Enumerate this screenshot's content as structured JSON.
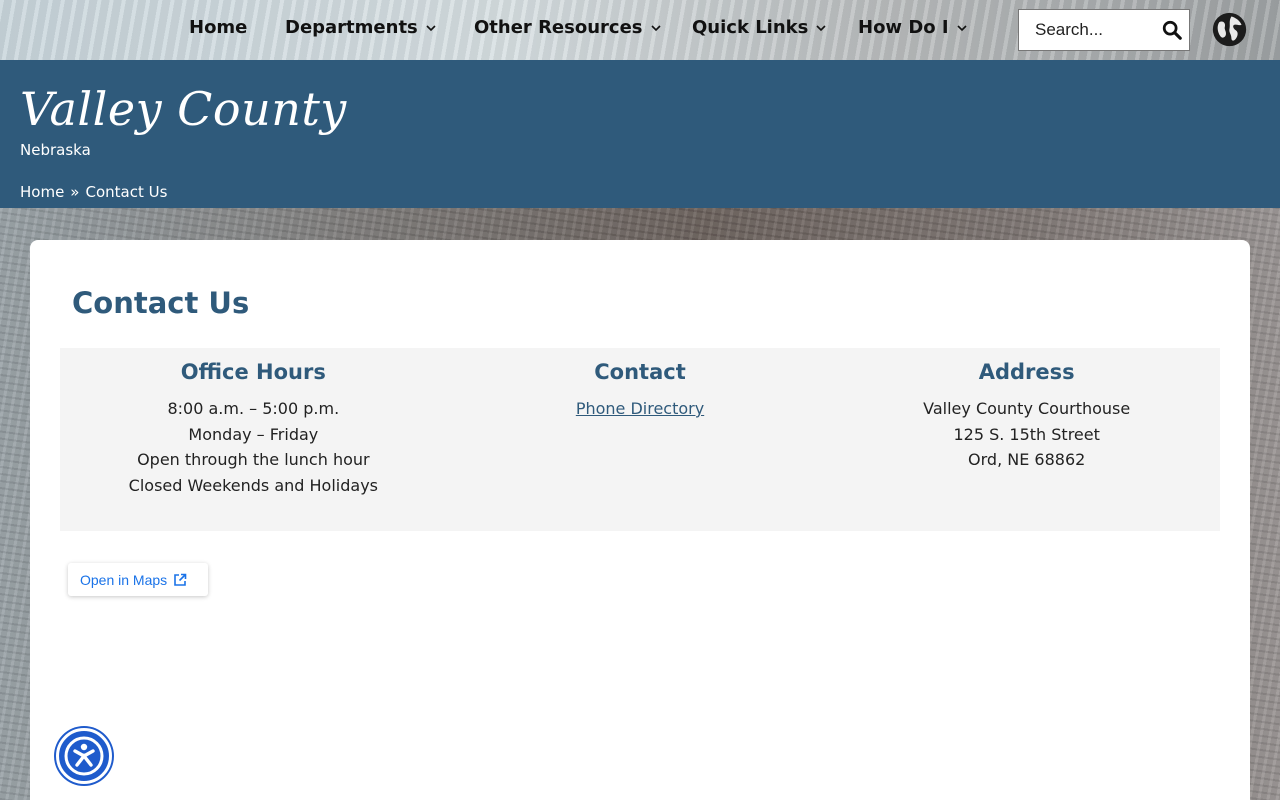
{
  "nav": {
    "items": [
      {
        "label": "Home",
        "dropdown": false
      },
      {
        "label": "Departments",
        "dropdown": true
      },
      {
        "label": "Other Resources",
        "dropdown": true
      },
      {
        "label": "Quick Links",
        "dropdown": true
      },
      {
        "label": "How Do I",
        "dropdown": true
      }
    ],
    "search_placeholder": "Search...",
    "icons": [
      "chevron-down-icon",
      "search-icon",
      "globe-icon"
    ]
  },
  "header": {
    "title": "Valley County",
    "subtitle": "Nebraska",
    "breadcrumb": [
      "Home",
      "»",
      "Contact Us"
    ]
  },
  "main": {
    "title": "Contact Us",
    "columns": {
      "hours": {
        "heading": "Office Hours",
        "lines": [
          "8:00 a.m. – 5:00 p.m.",
          "Monday – Friday",
          "Open through the lunch hour",
          "Closed Weekends and Holidays"
        ]
      },
      "contact": {
        "heading": "Contact",
        "link": "Phone Directory"
      },
      "address": {
        "heading": "Address",
        "lines": [
          "Valley County Courthouse",
          "125 S. 15th Street",
          "Ord, NE 68862"
        ]
      }
    },
    "maps_button": "Open in Maps"
  },
  "colors": {
    "brand_blue": "#2f5a7b",
    "panel_bg": "#f4f4f4",
    "link_blue": "#1a73e8",
    "a11y_blue": "#1f5bcc"
  }
}
